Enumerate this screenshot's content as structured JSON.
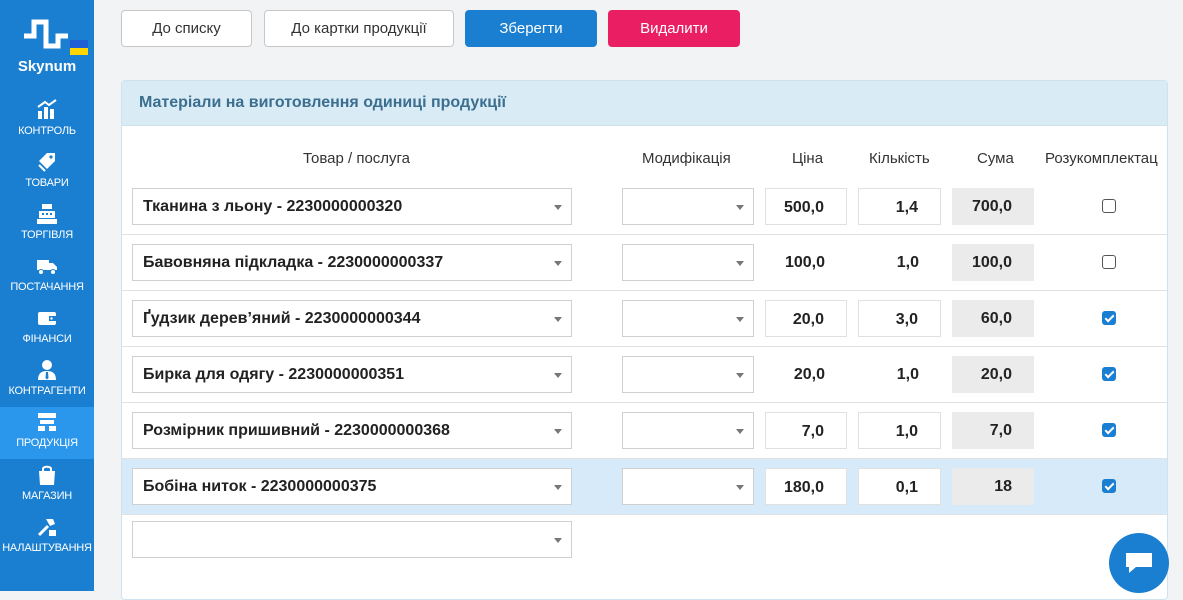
{
  "brand": {
    "name": "Skynum",
    "logo_icon": "skynum-logo-icon",
    "accent": "#1b7fd1"
  },
  "nav": [
    {
      "label": "КОНТРОЛЬ",
      "icon": "chart-icon",
      "active": false
    },
    {
      "label": "ТОВАРИ",
      "icon": "tags-icon",
      "active": false
    },
    {
      "label": "ТОРГІВЛЯ",
      "icon": "cash-register-icon",
      "active": false
    },
    {
      "label": "ПОСТАЧАННЯ",
      "icon": "truck-icon",
      "active": false
    },
    {
      "label": "ФІНАНСИ",
      "icon": "wallet-icon",
      "active": false
    },
    {
      "label": "КОНТРАГЕНТИ",
      "icon": "user-tie-icon",
      "active": false
    },
    {
      "label": "ПРОДУКЦІЯ",
      "icon": "production-icon",
      "active": true
    },
    {
      "label": "МАГАЗИН",
      "icon": "shopping-bag-icon",
      "active": false
    },
    {
      "label": "НАЛАШТУВАННЯ",
      "icon": "tools-icon",
      "active": false
    }
  ],
  "toolbar": {
    "to_list": "До списку",
    "to_card": "До картки продукції",
    "save": "Зберегти",
    "delete": "Видалити"
  },
  "panel": {
    "title": "Матеріали на виготовлення одиниці продукції",
    "columns": {
      "product": "Товар / послуга",
      "modification": "Модифікація",
      "price": "Ціна",
      "quantity": "Кількість",
      "sum": "Сума",
      "disassembly": "Розукомплектац"
    },
    "rows": [
      {
        "product": "Тканина з льону - 2230000000320",
        "modification": "",
        "price": "500,0",
        "quantity": "1,4",
        "sum": "700,0",
        "disassembly": false,
        "boxed": true,
        "highlight": false
      },
      {
        "product": "Бавовняна підкладка - 2230000000337",
        "modification": "",
        "price": "100,0",
        "quantity": "1,0",
        "sum": "100,0",
        "disassembly": false,
        "boxed": false,
        "highlight": false
      },
      {
        "product": "Ґудзик дерев’яний - 2230000000344",
        "modification": "",
        "price": "20,0",
        "quantity": "3,0",
        "sum": "60,0",
        "disassembly": true,
        "boxed": true,
        "highlight": false
      },
      {
        "product": "Бирка для одягу - 2230000000351",
        "modification": "",
        "price": "20,0",
        "quantity": "1,0",
        "sum": "20,0",
        "disassembly": true,
        "boxed": false,
        "highlight": false
      },
      {
        "product": "Розмірник пришивний - 2230000000368",
        "modification": "",
        "price": "7,0",
        "quantity": "1,0",
        "sum": "7,0",
        "disassembly": true,
        "boxed": true,
        "highlight": false
      },
      {
        "product": "Бобіна ниток - 2230000000375",
        "modification": "",
        "price": "180,0",
        "quantity": "0,1",
        "sum": "18",
        "disassembly": true,
        "boxed": true,
        "highlight": true
      }
    ]
  },
  "chat": {
    "icon": "chat-bubble-icon"
  }
}
